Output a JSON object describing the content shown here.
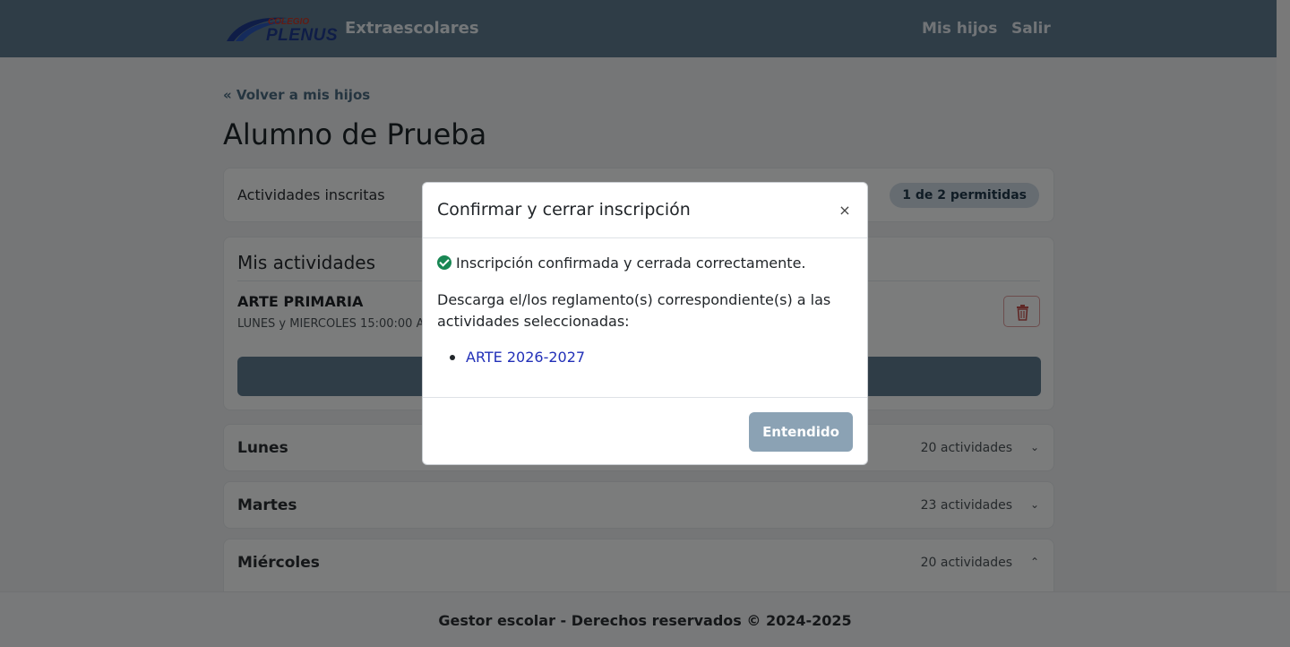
{
  "navbar": {
    "logo_small": "COLEGIO",
    "logo_text": "PLENUS",
    "brand": "Extraescolares",
    "links": [
      "Mis hijos",
      "Salir"
    ]
  },
  "page": {
    "back_link": "« Volver a mis hijos",
    "title": "Alumno de Prueba",
    "inscritas": {
      "label": "Actividades inscritas",
      "badge": "1 de 2 permitidas"
    },
    "mis_actividades": {
      "title": "Mis actividades",
      "items": [
        {
          "name": "ARTE PRIMARIA",
          "schedule": "LUNES y MIERCOLES 15:00:00 A 15"
        }
      ]
    },
    "days": [
      {
        "name": "Lunes",
        "count": "20 actividades",
        "chevron": "⌄"
      },
      {
        "name": "Martes",
        "count": "23 actividades",
        "chevron": "⌄"
      },
      {
        "name": "Miércoles",
        "count": "20 actividades",
        "chevron": "⌃"
      }
    ]
  },
  "footer": {
    "text": "Gestor escolar - Derechos reservados © 2024-2025"
  },
  "modal": {
    "title": "Confirmar y cerrar inscripción",
    "close": "×",
    "success": "Inscripción confirmada y cerrada correctamente.",
    "description": "Descarga el/los reglamento(s) correspondiente(s) a las actividades seleccionadas:",
    "documents": [
      "ARTE 2026-2027"
    ],
    "button": "Entendido"
  },
  "colors": {
    "navbar": "#5e7b8f",
    "success": "#198754",
    "link": "#2230b8",
    "primary_button": "#8ba2b4"
  }
}
